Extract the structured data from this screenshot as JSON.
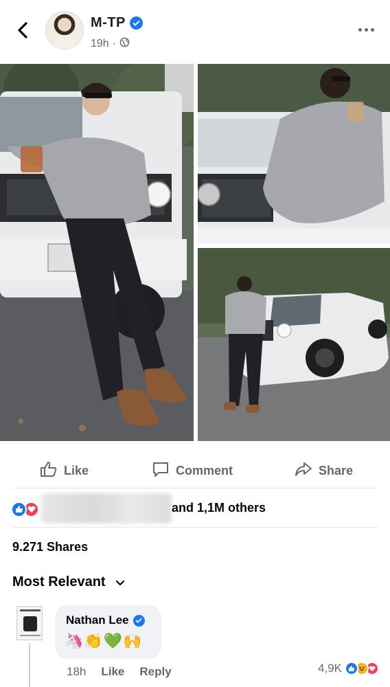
{
  "post": {
    "author": "M-TP",
    "time": "19h",
    "separator": "·"
  },
  "actions": {
    "like": "Like",
    "comment": "Comment",
    "share": "Share"
  },
  "reactions": {
    "others_text": "and 1,1M others"
  },
  "shares_text": "9.271 Shares",
  "sort_label": "Most Relevant",
  "comment": {
    "author": "Nathan Lee",
    "text": "🦄👏💚🙌",
    "time": "18h",
    "like_label": "Like",
    "reply_label": "Reply",
    "reaction_count": "4,9K"
  },
  "colors": {
    "facebook_blue": "#1877f2",
    "love_red": "#f33e58",
    "secondary_text": "#65676b"
  }
}
